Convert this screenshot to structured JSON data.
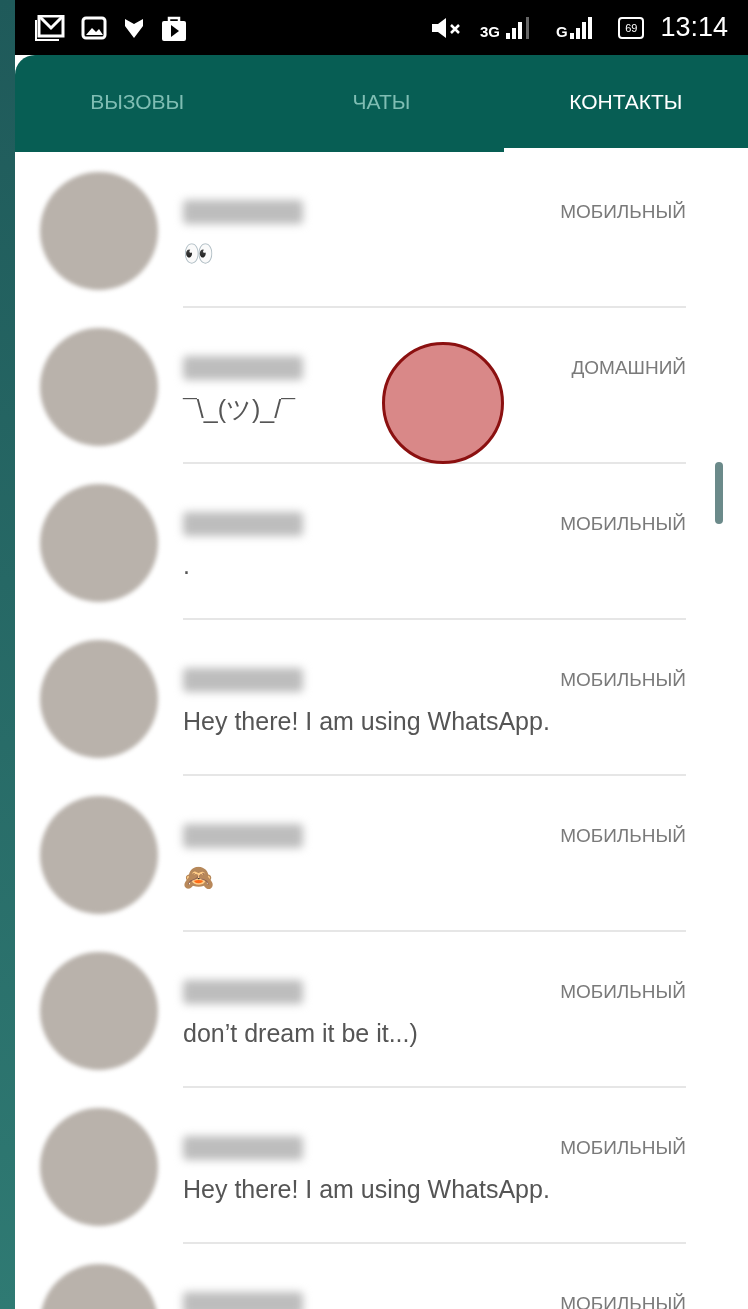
{
  "status_bar": {
    "network_1": "3G",
    "network_2": "G",
    "battery": "69",
    "time": "13:14"
  },
  "tabs": [
    {
      "label": "ВЫЗОВЫ",
      "selected": false
    },
    {
      "label": "ЧАТЫ",
      "selected": false
    },
    {
      "label": "КОНТАКТЫ",
      "selected": true
    }
  ],
  "contacts": [
    {
      "type": "МОБИЛЬНЫЙ",
      "status": "👀"
    },
    {
      "type": "ДОМАШНИЙ",
      "status": "¯\\_(ツ)_/¯"
    },
    {
      "type": "МОБИЛЬНЫЙ",
      "status": "."
    },
    {
      "type": "МОБИЛЬНЫЙ",
      "status": "Hey there! I am using WhatsApp."
    },
    {
      "type": "МОБИЛЬНЫЙ",
      "status": "🙈"
    },
    {
      "type": "МОБИЛЬНЫЙ",
      "status": "don’t dream it be it...)"
    },
    {
      "type": "МОБИЛЬНЫЙ",
      "status": "Hey there! I am using WhatsApp."
    },
    {
      "type": "МОБИЛЬНЫЙ"
    }
  ]
}
